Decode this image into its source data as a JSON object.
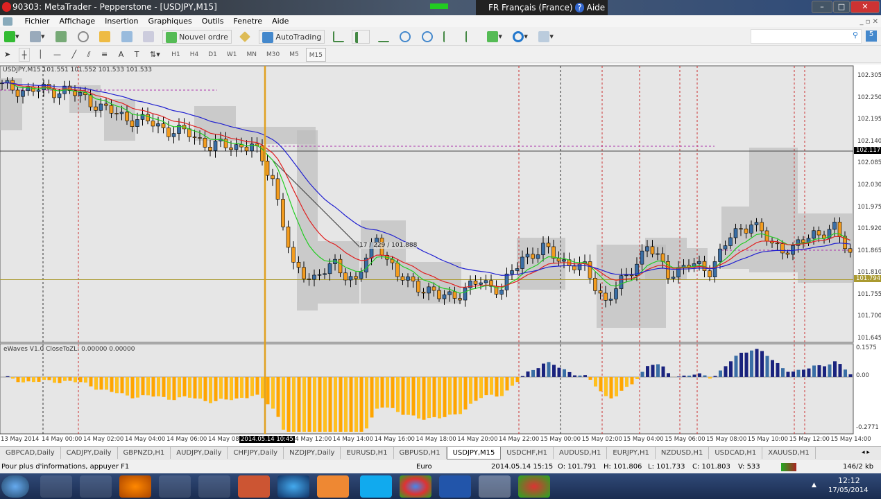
{
  "window": {
    "title": "90303: MetaTrader - Pepperstone - [USDJPY,M15]",
    "lang": "FR Français (France)",
    "help": "Aide"
  },
  "menu": [
    "Fichier",
    "Affichage",
    "Insertion",
    "Graphiques",
    "Outils",
    "Fenetre",
    "Aide"
  ],
  "toolbar": {
    "new_order": "Nouvel ordre",
    "autotrading": "AutoTrading",
    "timeframes": [
      "H1",
      "H4",
      "D1",
      "W1",
      "MN",
      "M30",
      "M5",
      "M15"
    ],
    "active_tf": "M15"
  },
  "chart": {
    "header": "USDJPY,M15  101.551 101.552 101.533 101.533",
    "price_ticks": [
      "102.305",
      "102.250",
      "102.195",
      "102.140",
      "102.085",
      "102.030",
      "101.975",
      "101.920",
      "101.865",
      "101.810",
      "101.755",
      "101.700",
      "101.645"
    ],
    "price_range": [
      101.645,
      102.305
    ],
    "bid_label": "102.117",
    "bid_price": 102.117,
    "line_label": "101.794",
    "line_price": 101.794,
    "crosshair": "17 / 229 / 101.888",
    "closes": [
      102.28,
      102.27,
      102.27,
      102.27,
      102.25,
      102.22,
      102.2,
      102.19,
      102.17,
      102.16,
      102.13,
      102.13,
      102.13,
      102.05,
      101.82,
      101.8,
      101.83,
      101.79,
      101.9,
      101.8,
      101.78,
      101.75,
      101.76,
      101.79,
      101.77,
      101.85,
      101.87,
      101.84,
      101.82,
      101.74,
      101.8,
      101.88,
      101.81,
      101.83,
      101.82,
      101.9,
      101.94,
      101.88,
      101.87,
      101.91,
      101.92,
      101.84
    ],
    "colors": {
      "bull": "#3a6ea5",
      "bear": "#f39c1e",
      "ma_fast": "#22cc22",
      "ma_mid": "#e02020",
      "ma_slow": "#2020d0",
      "ind_pos": "#1a237e",
      "ind_neg": "#ffa500"
    }
  },
  "indicator": {
    "label": "eWaves V1.0 CloseToZL: 0.00000 0.00000",
    "ticks": [
      "0.1575",
      "0.00",
      "-0.2771"
    ],
    "range": [
      -0.2771,
      0.1575
    ]
  },
  "time_labels": [
    "13 May 2014",
    "14 May 00:00",
    "14 May 02:00",
    "14 May 04:00",
    "14 May 06:00",
    "14 May 08:",
    "2014.05.14 10:45",
    "14 May 12:00",
    "14 May 14:00",
    "14 May 16:00",
    "14 May 18:00",
    "14 May 20:00",
    "14 May 22:00",
    "15 May 00:00",
    "15 May 02:00",
    "15 May 04:00",
    "15 May 06:00",
    "15 May 08:00",
    "15 May 10:00",
    "15 May 12:00",
    "15 May 14:00"
  ],
  "tabs": [
    "GBPCAD,Daily",
    "CADJPY,Daily",
    "GBPNZD,H1",
    "AUDJPY,Daily",
    "CHFJPY,Daily",
    "NZDJPY,Daily",
    "EURUSD,H1",
    "GBPUSD,H1",
    "USDJPY,M15",
    "USDCHF,H1",
    "AUDUSD,H1",
    "EURJPY,H1",
    "NZDUSD,H1",
    "USDCAD,H1",
    "XAUUSD,H1"
  ],
  "active_tab": "USDJPY,M15",
  "status": {
    "help": "Pour plus d'informations, appuyer F1",
    "profile": "Euro",
    "datetime": "2014.05.14 15:15",
    "open": "O: 101.791",
    "high": "H: 101.806",
    "low": "L: 101.733",
    "close": "C: 101.803",
    "volume": "V: 533",
    "traffic": "146/2 kb"
  },
  "taskbar": {
    "time": "12:12",
    "date": "17/05/2014"
  }
}
